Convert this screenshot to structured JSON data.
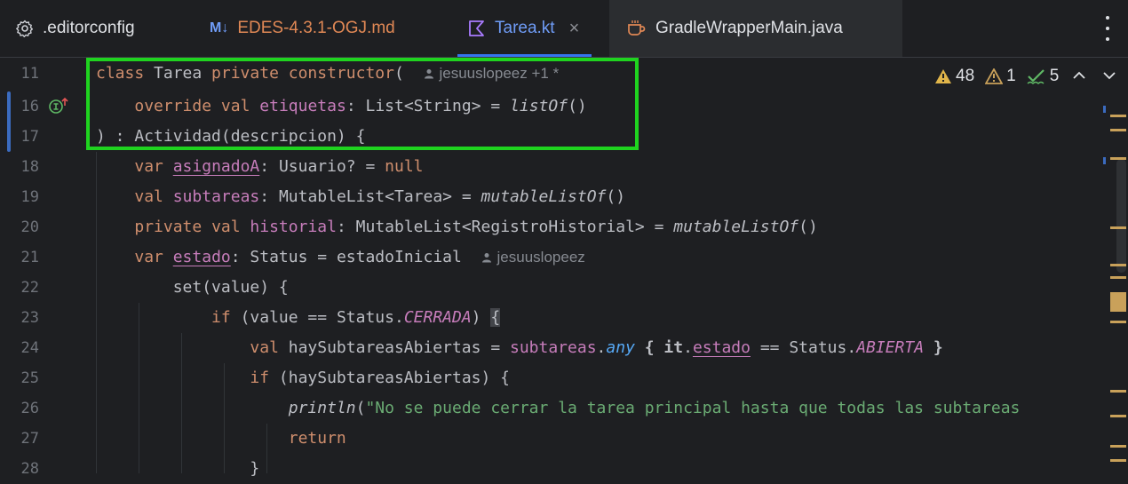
{
  "tabs": [
    {
      "label": ".editorconfig",
      "icon": "gear-icon"
    },
    {
      "label": "EDES-4.3.1-OGJ.md",
      "icon": "markdown-icon",
      "icon_text": "M↓"
    },
    {
      "label": "Tarea.kt",
      "icon": "kotlin-file-icon",
      "active": true,
      "close": "×"
    },
    {
      "label": "GradleWrapperMain.java",
      "icon": "java-file-icon"
    }
  ],
  "inspections": {
    "warnings": "48",
    "weak_warnings": "1",
    "ok": "5"
  },
  "line_numbers": [
    "11",
    "16",
    "17",
    "18",
    "19",
    "20",
    "21",
    "22",
    "23",
    "24",
    "25",
    "26",
    "27",
    "28"
  ],
  "code": {
    "l11": {
      "class_kw": "class",
      "name": " Tarea ",
      "private_kw": "private",
      "sp": " ",
      "ctor_kw": "constructor",
      "paren": "(",
      "author": "jesuuslopeez +1 *"
    },
    "l16": {
      "override_kw": "override",
      "val_kw": "val",
      "prop": "etiquetas",
      "rest": ": List<String> = ",
      "fn": "listOf",
      "end": "()"
    },
    "l17": {
      "text": ") : Actividad(descripcion) {"
    },
    "l18": {
      "var_kw": "var",
      "prop": "asignadoA",
      "rest": ": Usuario? = ",
      "null_kw": "null"
    },
    "l19": {
      "val_kw": "val",
      "prop": "subtareas",
      "rest": ": MutableList<Tarea> = ",
      "fn": "mutableListOf",
      "end": "()"
    },
    "l20": {
      "private_kw": "private",
      "val_kw": "val",
      "prop": "historial",
      "rest": ": MutableList<RegistroHistorial> = ",
      "fn": "mutableListOf",
      "end": "()"
    },
    "l21": {
      "var_kw": "var",
      "prop": "estado",
      "rest": ": Status = estadoInicial",
      "author": "jesuuslopeez"
    },
    "l22": {
      "text": "set(value) {"
    },
    "l23": {
      "if_kw": "if",
      "pre": " (value == Status.",
      "const": "CERRADA",
      "post": ") ",
      "brace": "{"
    },
    "l24": {
      "val_kw": "val",
      "pre": " haySubtareasAbiertas = ",
      "prop": "subtareas",
      "dot": ".",
      "fn": "any",
      "b1": " { ",
      "it": "it",
      "dot2": ".",
      "prop2": "estado",
      "mid": " == Status.",
      "const": "ABIERTA",
      "b2": " }"
    },
    "l25": {
      "if_kw": "if",
      "rest": " (haySubtareasAbiertas) {"
    },
    "l26": {
      "fn": "println",
      "paren": "(",
      "str": "\"No se puede cerrar la tarea principal hasta que todas las subtareas"
    },
    "l27": {
      "return_kw": "return"
    },
    "l28": {
      "text": "}"
    }
  },
  "colors": {
    "accent": "#3574f0",
    "keyword": "#cf8e6d",
    "property": "#c77dbb",
    "string": "#6aab73",
    "highlight_box": "#1fd31f"
  }
}
